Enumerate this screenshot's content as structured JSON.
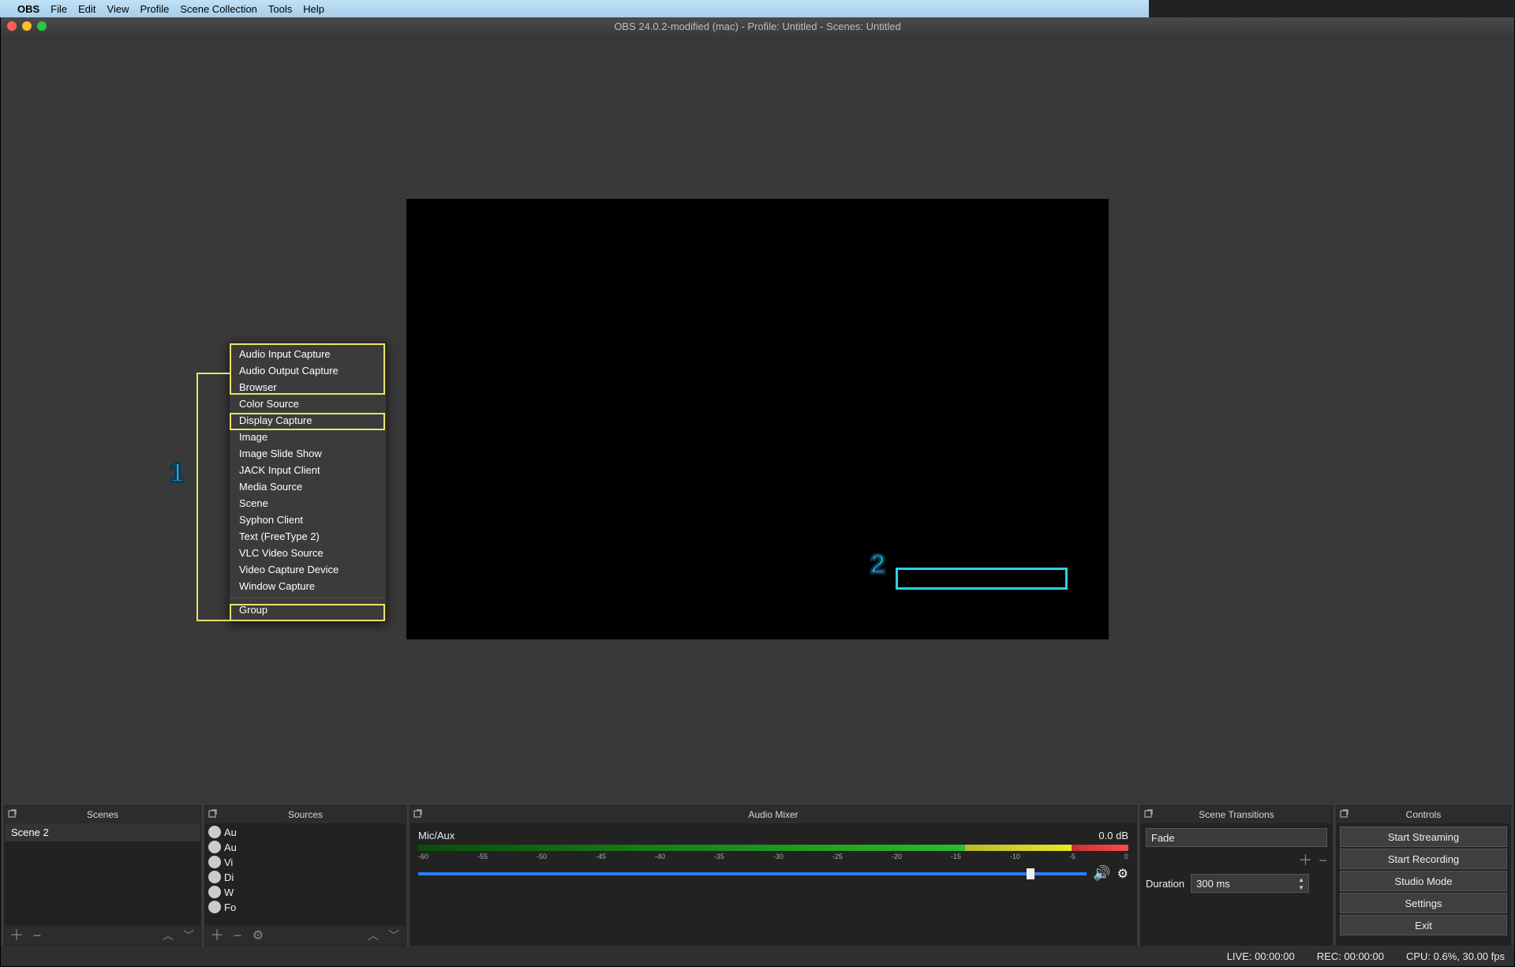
{
  "menubar": {
    "app": "OBS",
    "items": [
      "File",
      "Edit",
      "View",
      "Profile",
      "Scene Collection",
      "Tools",
      "Help"
    ]
  },
  "window": {
    "title": "OBS 24.0.2-modified (mac) - Profile: Untitled - Scenes: Untitled"
  },
  "docks": {
    "scenes": {
      "title": "Scenes",
      "items": [
        "Scene 2"
      ]
    },
    "sources": {
      "title": "Sources",
      "rows_truncated": [
        "Au",
        "Au",
        "Vi",
        "Di",
        "W",
        "Fo"
      ]
    },
    "mixer": {
      "title": "Audio Mixer",
      "channel": {
        "name": "Mic/Aux",
        "level": "0.0 dB"
      },
      "ticks": [
        "-60",
        "-55",
        "-50",
        "-45",
        "-40",
        "-35",
        "-30",
        "-25",
        "-20",
        "-15",
        "-10",
        "-5",
        "0"
      ]
    },
    "transitions": {
      "title": "Scene Transitions",
      "selected": "Fade",
      "duration_label": "Duration",
      "duration_value": "300 ms"
    },
    "controls": {
      "title": "Controls",
      "buttons": [
        "Start Streaming",
        "Start Recording",
        "Studio Mode",
        "Settings",
        "Exit"
      ]
    }
  },
  "status": {
    "live": "LIVE: 00:00:00",
    "rec": "REC: 00:00:00",
    "cpu": "CPU: 0.6%, 30.00 fps"
  },
  "context_menu": {
    "items": [
      "Audio Input Capture",
      "Audio Output Capture",
      "Browser",
      "Color Source",
      "Display Capture",
      "Image",
      "Image Slide Show",
      "JACK Input Client",
      "Media Source",
      "Scene",
      "Syphon Client",
      "Text (FreeType 2)",
      "VLC Video Source",
      "Video Capture Device",
      "Window Capture"
    ],
    "group": "Group"
  },
  "annotations": {
    "num1": "1",
    "num2": "2"
  }
}
